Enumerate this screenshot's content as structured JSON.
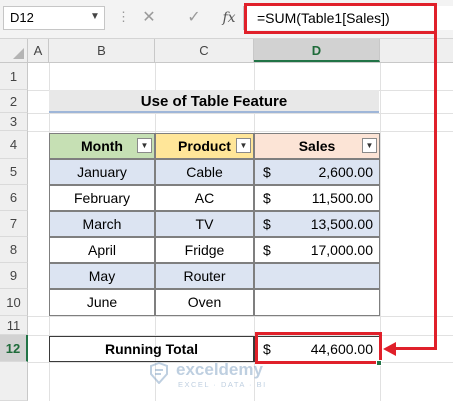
{
  "formula_bar": {
    "name_box": "D12",
    "cancel_icon": "✕",
    "enter_icon": "✓",
    "fx_label": "fx",
    "formula": "=SUM(Table1[Sales])"
  },
  "columns": [
    "A",
    "B",
    "C",
    "D"
  ],
  "rows": [
    "1",
    "2",
    "3",
    "4",
    "5",
    "6",
    "7",
    "8",
    "9",
    "10",
    "11",
    "12"
  ],
  "title": "Use of Table Feature",
  "table": {
    "headers": [
      "Month",
      "Product",
      "Sales"
    ],
    "rows": [
      {
        "month": "January",
        "product": "Cable",
        "currency": "$",
        "sales": "2,600.00"
      },
      {
        "month": "February",
        "product": "AC",
        "currency": "$",
        "sales": "11,500.00"
      },
      {
        "month": "March",
        "product": "TV",
        "currency": "$",
        "sales": "13,500.00"
      },
      {
        "month": "April",
        "product": "Fridge",
        "currency": "$",
        "sales": "17,000.00"
      },
      {
        "month": "May",
        "product": "Router",
        "currency": "",
        "sales": ""
      },
      {
        "month": "June",
        "product": "Oven",
        "currency": "",
        "sales": ""
      }
    ],
    "header_colors": {
      "month": "#c6e0b4",
      "product": "#ffe699",
      "sales": "#fce4d6"
    },
    "band_color": "#dce4f2"
  },
  "total": {
    "label": "Running Total",
    "currency": "$",
    "value": "44,600.00"
  },
  "highlight_color": "#e0202a",
  "watermark": {
    "name": "exceldemy",
    "tagline": "EXCEL · DATA · BI"
  }
}
